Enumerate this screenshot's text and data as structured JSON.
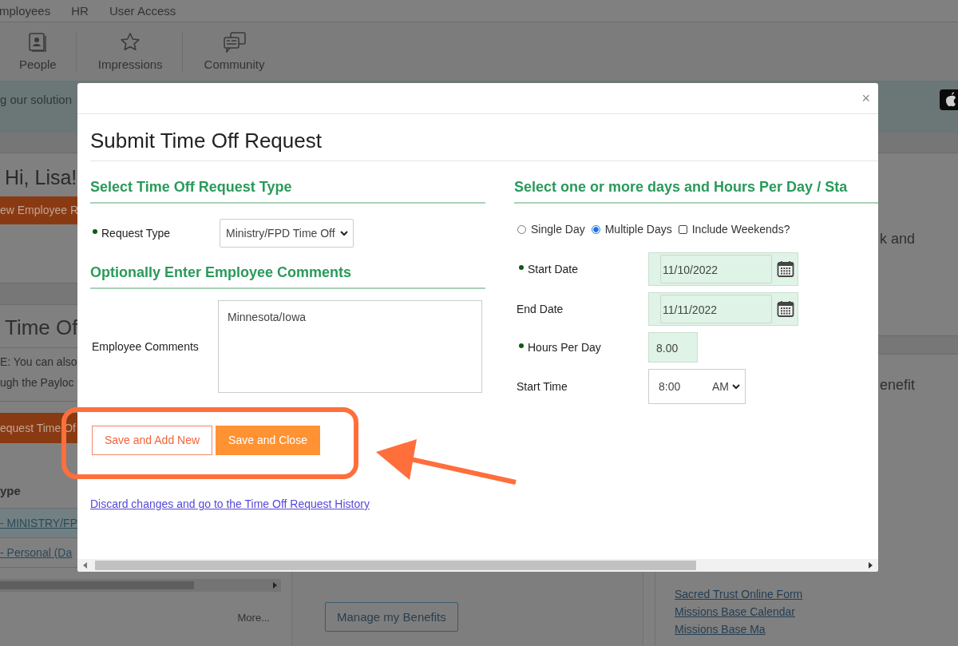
{
  "top_nav": {
    "items": [
      "mployees",
      "HR",
      "User Access"
    ]
  },
  "toolbar": {
    "items": [
      {
        "label": "People",
        "kind": "people"
      },
      {
        "label": "Impressions",
        "kind": "star"
      },
      {
        "label": "Community",
        "kind": "chat"
      }
    ]
  },
  "banner": {
    "text": "g our solution"
  },
  "left_panel": {
    "greeting": "Hi, Lisa!",
    "new_button": "ew Employee R",
    "section_title": "Time Of",
    "note_lines": [
      "E: You can also",
      "ugh the Payloc"
    ],
    "request_button": "equest Time Of",
    "table": {
      "header": "ype",
      "rows": [
        {
          "text": "- MINISTRY/FP",
          "selected": true
        },
        {
          "text": "- Personal (Da",
          "selected": false
        }
      ]
    },
    "more": "More..."
  },
  "middle_panel": {
    "button": "Manage my Benefits"
  },
  "right_panel": {
    "texts": [
      "k and",
      "enefit"
    ],
    "links": [
      "Sacred Trust Online Form",
      "Missions Base Calendar",
      "Missions Base Ma"
    ]
  },
  "dialog": {
    "title": "Submit Time Off Request",
    "close": "×",
    "left": {
      "type_heading": "Select Time Off Request Type",
      "request_type": {
        "label": "Request Type",
        "required": true,
        "value": "Ministry/FPD Time Off"
      },
      "comments_heading": "Optionally Enter Employee Comments",
      "comments": {
        "label": "Employee Comments",
        "value": "Minnesota/Iowa"
      },
      "buttons": [
        {
          "label": "Save and Add New",
          "kind": "secondary"
        },
        {
          "label": "Save and Close",
          "kind": "primary"
        }
      ],
      "discard_link": "Discard changes and go to the Time Off Request History"
    },
    "right": {
      "heading": "Select one or more days and Hours Per Day / Sta",
      "day_options": [
        {
          "label": "Single Day",
          "selected": false
        },
        {
          "label": "Multiple Days",
          "selected": true
        }
      ],
      "include_weekends": {
        "label": "Include Weekends?",
        "checked": false
      },
      "fields": [
        {
          "label": "Start Date",
          "required": true,
          "kind": "date",
          "value": "11/10/2022"
        },
        {
          "label": "End Date",
          "required": false,
          "kind": "date",
          "value": "11/11/2022"
        },
        {
          "label": "Hours Per Day",
          "required": true,
          "kind": "number",
          "value": "8.00"
        },
        {
          "label": "Start Time",
          "required": false,
          "kind": "time",
          "value": "8:00",
          "period": "AM"
        }
      ]
    }
  }
}
